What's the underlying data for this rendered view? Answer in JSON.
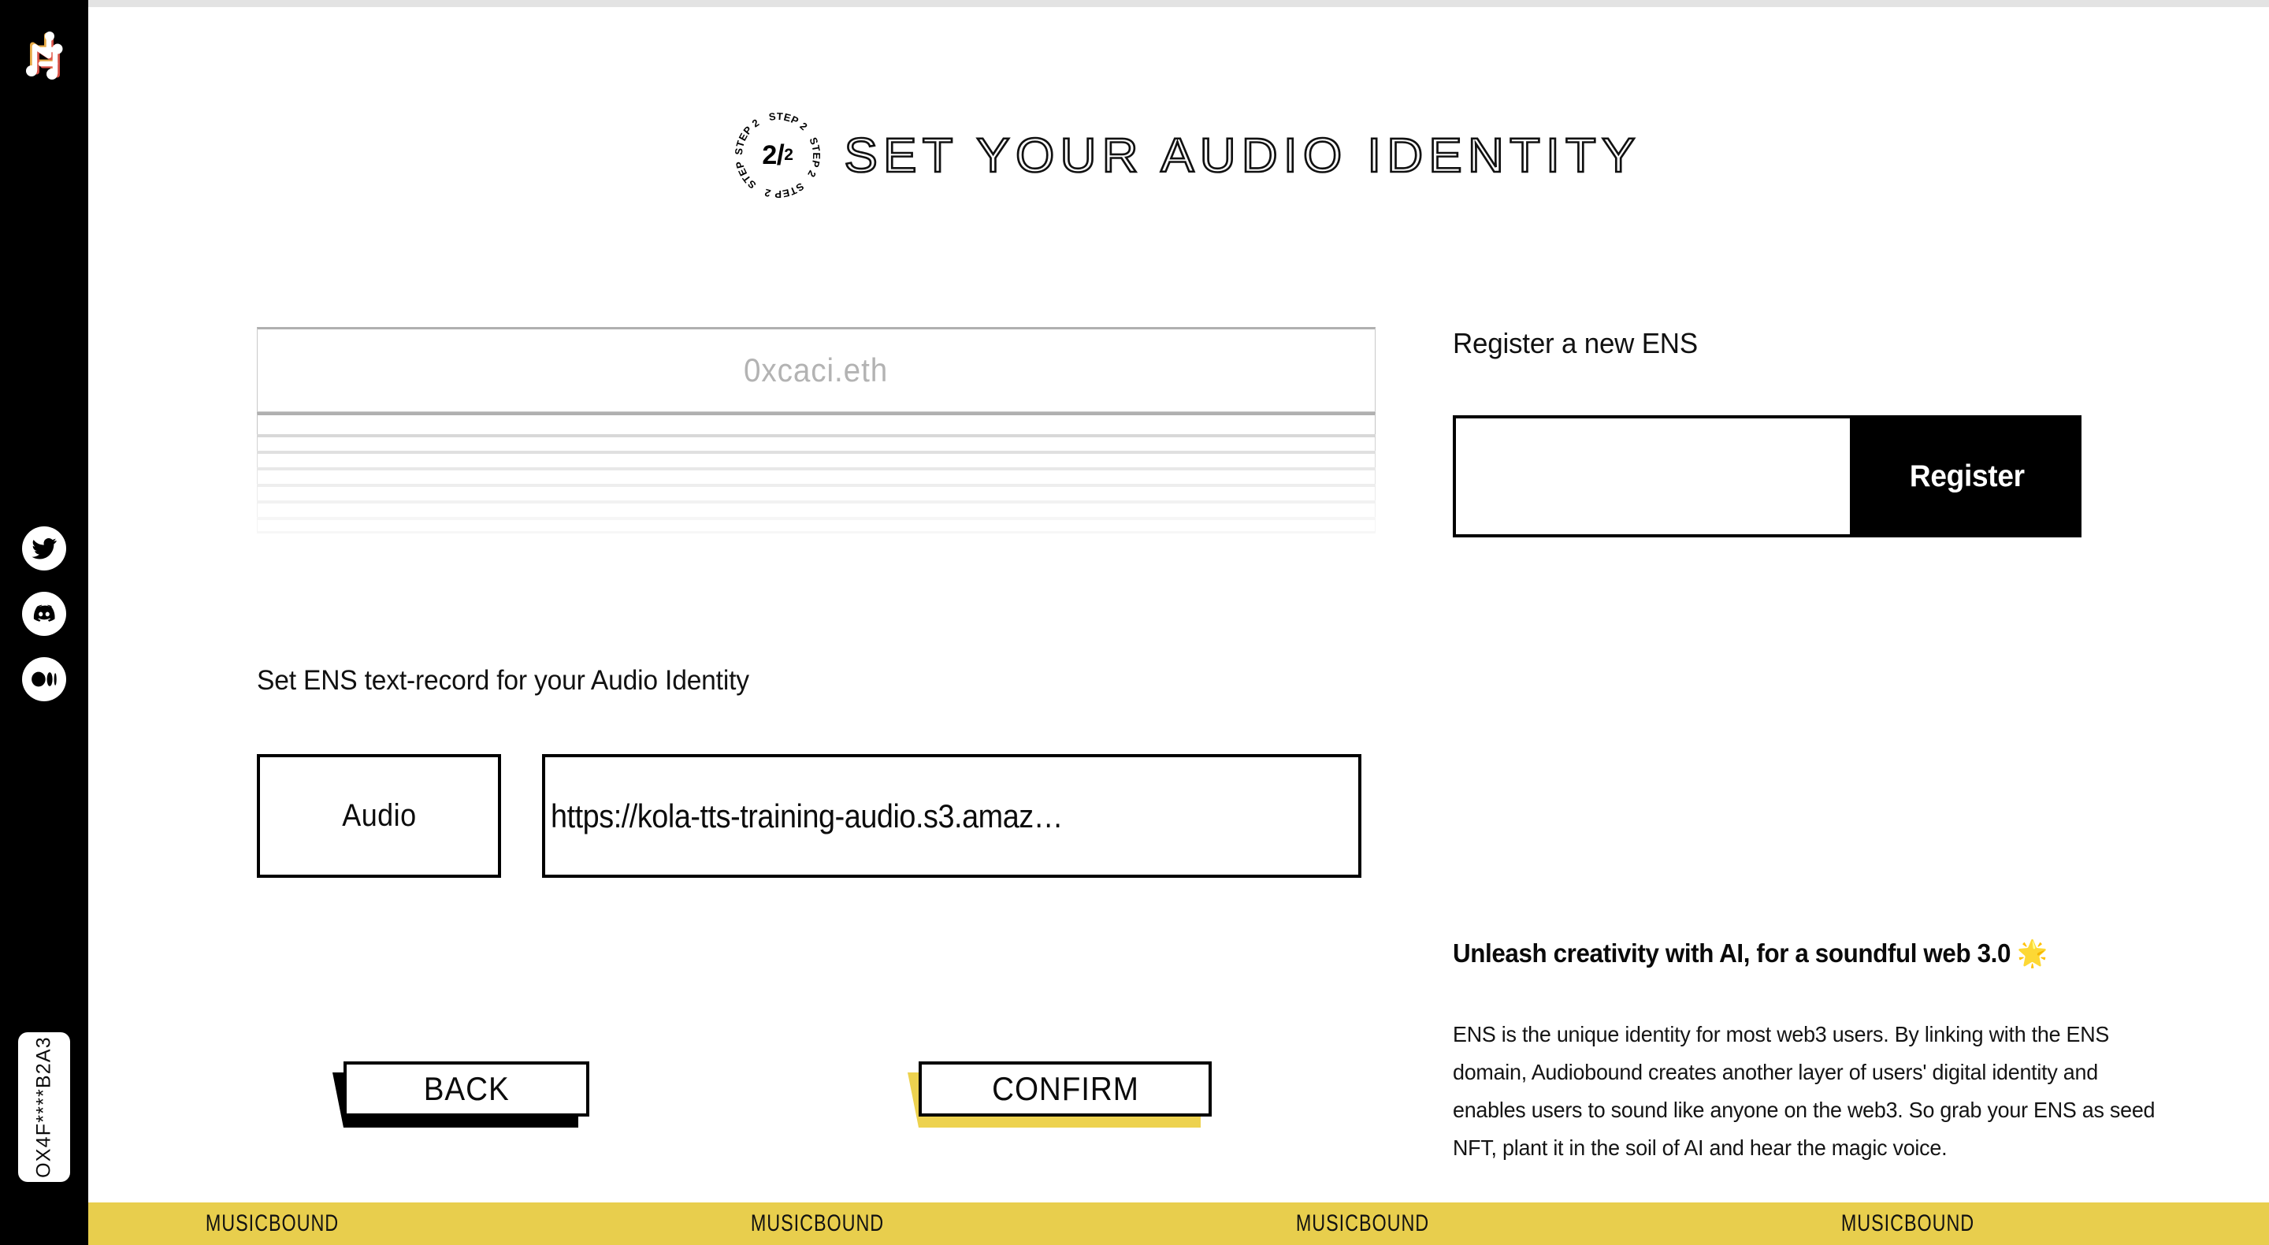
{
  "brand": {
    "name": "Audiobound",
    "logo_icon": "music-note-network-logo"
  },
  "sidebar": {
    "socials": [
      {
        "icon": "twitter-icon",
        "label": "Twitter"
      },
      {
        "icon": "discord-icon",
        "label": "Discord"
      },
      {
        "icon": "medium-icon",
        "label": "Medium"
      }
    ],
    "wallet": {
      "address_short": "OX4F****B2A3"
    }
  },
  "header": {
    "step_badge": {
      "ring_text": "STEP 2",
      "current": "2",
      "total": "2",
      "separator": "/"
    },
    "title": "SET YOUR AUDIO IDENTITY"
  },
  "ens_select": {
    "selected_value": "0xcaci.eth",
    "placeholder": "0xcaci.eth",
    "options": [
      "",
      "",
      "",
      "",
      "",
      "",
      ""
    ],
    "is_open": true
  },
  "text_record": {
    "section_label": "Set ENS text-record for your Audio Identity",
    "key_label": "Audio",
    "value": "https://kola-tts-training-audio.s3.amaz…",
    "value_placeholder": "https://"
  },
  "register": {
    "title": "Register a new ENS",
    "input_value": "",
    "input_placeholder": "",
    "button_label": "Register"
  },
  "promo": {
    "headline": "Unleash creativity with AI, for a soundful web 3.0 🌟",
    "body": "ENS is the unique identity for most web3 users. By linking with the ENS domain, Audiobound creates another layer of users' digital identity and enables users to sound like anyone on the web3. So grab your ENS as seed NFT, plant it in the soil of AI and hear the magic voice."
  },
  "actions": {
    "back_label": "BACK",
    "confirm_label": "CONFIRM"
  },
  "marquee": {
    "items": [
      "MUSICBOUND",
      "MUSICBOUND",
      "MUSICBOUND",
      "MUSICBOUND"
    ]
  },
  "colors": {
    "accent_yellow": "#e8ce4d",
    "confirm_yellow": "#edd24f",
    "sidebar_black": "#000000",
    "page_white": "#ffffff",
    "placeholder_gray": "#b3b3b3"
  }
}
